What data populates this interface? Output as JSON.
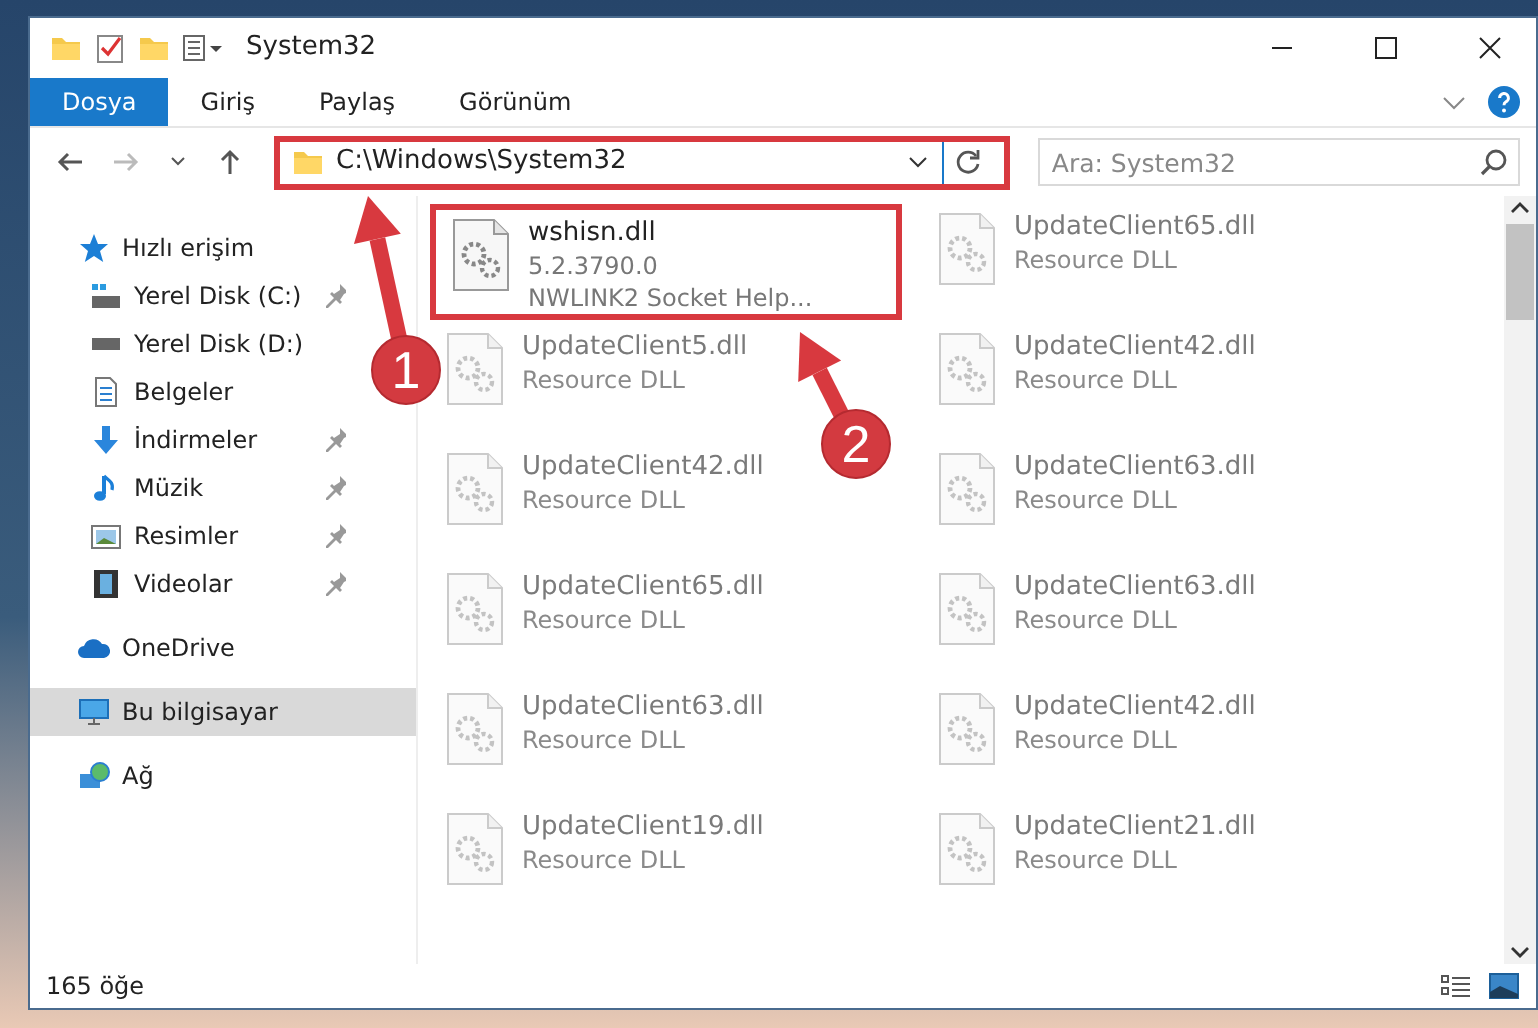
{
  "window": {
    "title": "System32"
  },
  "ribbon_tabs": [
    {
      "label": "Dosya",
      "selected": true
    },
    {
      "label": "Giriş",
      "selected": false
    },
    {
      "label": "Paylaş",
      "selected": false
    },
    {
      "label": "Görünüm",
      "selected": false
    }
  ],
  "address": {
    "path": "C:\\Windows\\System32",
    "highlighted": true
  },
  "search": {
    "placeholder": "Ara: System32"
  },
  "sidebar": {
    "items": [
      {
        "label": "Hızlı erişim",
        "selected": false,
        "children": [
          {
            "label": "Yerel Disk (C:)",
            "pinned": true
          },
          {
            "label": "Yerel Disk (D:)",
            "pinned": false
          },
          {
            "label": "Belgeler",
            "pinned": false
          },
          {
            "label": "İndirmeler",
            "pinned": true
          },
          {
            "label": "Müzik",
            "pinned": true
          },
          {
            "label": "Resimler",
            "pinned": true
          },
          {
            "label": "Videolar",
            "pinned": true
          }
        ]
      },
      {
        "label": "OneDrive",
        "selected": false
      },
      {
        "label": "Bu bilgisayar",
        "selected": true
      },
      {
        "label": "Ağ",
        "selected": false
      }
    ]
  },
  "files": [
    {
      "name": "wshisn.dll",
      "details": [
        "5.2.3790.0",
        "NWLINK2 Socket Help..."
      ],
      "highlighted": true
    },
    {
      "name": "UpdateClient65.dll",
      "details": [
        "Resource DLL"
      ],
      "highlighted": false
    },
    {
      "name": "UpdateClient5.dll",
      "details": [
        "Resource DLL"
      ],
      "highlighted": false
    },
    {
      "name": "UpdateClient42.dll",
      "details": [
        "Resource DLL"
      ],
      "highlighted": false
    },
    {
      "name": "UpdateClient42.dll",
      "details": [
        "Resource DLL"
      ],
      "highlighted": false
    },
    {
      "name": "UpdateClient63.dll",
      "details": [
        "Resource DLL"
      ],
      "highlighted": false
    },
    {
      "name": "UpdateClient65.dll",
      "details": [
        "Resource DLL"
      ],
      "highlighted": false
    },
    {
      "name": "UpdateClient63.dll",
      "details": [
        "Resource DLL"
      ],
      "highlighted": false
    },
    {
      "name": "UpdateClient63.dll",
      "details": [
        "Resource DLL"
      ],
      "highlighted": false
    },
    {
      "name": "UpdateClient42.dll",
      "details": [
        "Resource DLL"
      ],
      "highlighted": false
    },
    {
      "name": "UpdateClient19.dll",
      "details": [
        "Resource DLL"
      ],
      "highlighted": false
    },
    {
      "name": "UpdateClient21.dll",
      "details": [
        "Resource DLL"
      ],
      "highlighted": false
    }
  ],
  "status_bar": {
    "item_count": "165 öğe"
  },
  "annotations": [
    {
      "label": "1"
    },
    {
      "label": "2"
    }
  ]
}
